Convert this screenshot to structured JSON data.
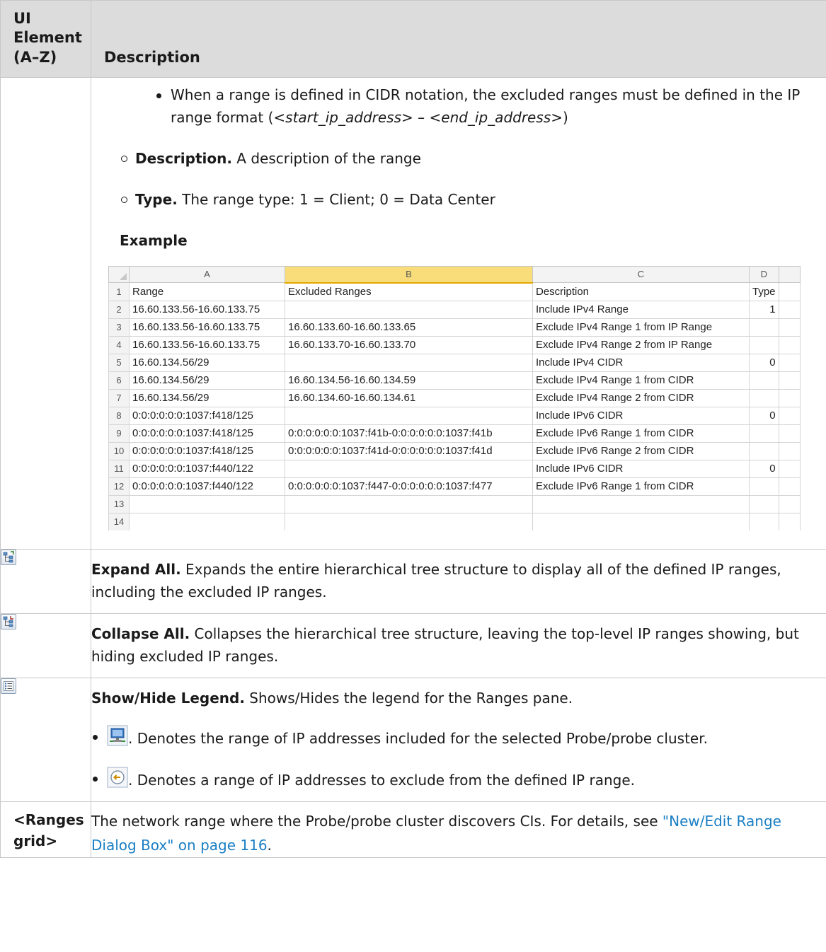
{
  "header": {
    "col1": "UI Element (A–Z)",
    "col2": "Description"
  },
  "top_row": {
    "cidr_note_prefix": "When a range is defined in CIDR notation, the excluded ranges must be defined in the IP range format (",
    "cidr_note_start": "<start_ip_address>",
    "cidr_note_sep": " – ",
    "cidr_note_end": "<end_ip_address>",
    "cidr_note_suffix": ")",
    "description_label": "Description.",
    "description_text": " A description of the range",
    "type_label": "Type.",
    "type_text": " The range type: 1 = Client; 0 = Data Center",
    "example_heading": "Example"
  },
  "spreadsheet": {
    "column_letters": [
      "A",
      "B",
      "C",
      "D"
    ],
    "selected_column": "B",
    "rows": [
      {
        "n": "1",
        "a": "Range",
        "b": "Excluded Ranges",
        "c": "Description",
        "d": "Type"
      },
      {
        "n": "2",
        "a": "16.60.133.56-16.60.133.75",
        "b": "",
        "c": "Include IPv4 Range",
        "d": "1"
      },
      {
        "n": "3",
        "a": "16.60.133.56-16.60.133.75",
        "b": "16.60.133.60-16.60.133.65",
        "c": "Exclude IPv4 Range 1 from IP Range",
        "d": ""
      },
      {
        "n": "4",
        "a": "16.60.133.56-16.60.133.75",
        "b": "16.60.133.70-16.60.133.70",
        "c": "Exclude IPv4 Range 2 from IP Range",
        "d": ""
      },
      {
        "n": "5",
        "a": "16.60.134.56/29",
        "b": "",
        "c": "Include IPv4 CIDR",
        "d": "0"
      },
      {
        "n": "6",
        "a": "16.60.134.56/29",
        "b": "16.60.134.56-16.60.134.59",
        "c": "Exclude IPv4 Range 1 from CIDR",
        "d": ""
      },
      {
        "n": "7",
        "a": "16.60.134.56/29",
        "b": "16.60.134.60-16.60.134.61",
        "c": "Exclude IPv4 Range 2 from CIDR",
        "d": ""
      },
      {
        "n": "8",
        "a": "0:0:0:0:0:0:1037:f418/125",
        "b": "",
        "c": "Include IPv6 CIDR",
        "d": "0"
      },
      {
        "n": "9",
        "a": "0:0:0:0:0:0:1037:f418/125",
        "b": "0:0:0:0:0:0:1037:f41b-0:0:0:0:0:0:1037:f41b",
        "c": "Exclude IPv6 Range 1 from CIDR",
        "d": ""
      },
      {
        "n": "10",
        "a": "0:0:0:0:0:0:1037:f418/125",
        "b": "0:0:0:0:0:0:1037:f41d-0:0:0:0:0:0:1037:f41d",
        "c": "Exclude IPv6 Range 2 from CIDR",
        "d": ""
      },
      {
        "n": "11",
        "a": "0:0:0:0:0:0:1037:f440/122",
        "b": "",
        "c": "Include IPv6 CIDR",
        "d": "0"
      },
      {
        "n": "12",
        "a": "0:0:0:0:0:0:1037:f440/122",
        "b": "0:0:0:0:0:0:1037:f447-0:0:0:0:0:0:1037:f477",
        "c": "Exclude IPv6 Range 1 from CIDR",
        "d": ""
      },
      {
        "n": "13",
        "a": "",
        "b": "",
        "c": "",
        "d": ""
      },
      {
        "n": "14",
        "a": "",
        "b": "",
        "c": "",
        "d": ""
      }
    ]
  },
  "expand_all": {
    "icon": "expand-all-icon",
    "label": "Expand All.",
    "text": " Expands the entire hierarchical tree structure to display all of the defined IP ranges, including the excluded IP ranges."
  },
  "collapse_all": {
    "icon": "collapse-all-icon",
    "label": "Collapse All.",
    "text": " Collapses the hierarchical tree structure, leaving the top-level IP ranges showing, but hiding excluded IP ranges."
  },
  "legend": {
    "icon": "legend-icon",
    "label": "Show/Hide Legend.",
    "text": " Shows/Hides the legend for the Ranges pane.",
    "items": [
      {
        "icon": "included-range-icon",
        "text": ". Denotes the range of IP addresses included for the selected Probe/probe cluster."
      },
      {
        "icon": "excluded-range-icon",
        "text": ". Denotes a range of IP addresses to exclude from the defined IP range."
      }
    ]
  },
  "ranges_grid": {
    "label": "<Ranges grid>",
    "text": "The network range where the Probe/probe cluster discovers CIs. For details, see ",
    "link_text": "\"New/Edit Range Dialog Box\" on page 116",
    "text_end": "."
  },
  "colors": {
    "header_bg": "#dcdcdc",
    "link": "#1a7fc4",
    "selected_column": "#f8dd7a"
  }
}
